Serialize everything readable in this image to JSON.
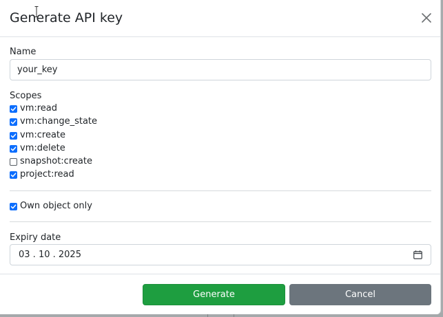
{
  "dialog": {
    "title": "Generate API key",
    "close_icon": "close-icon"
  },
  "name_field": {
    "label": "Name",
    "value": "your_key"
  },
  "scopes": {
    "label": "Scopes",
    "items": [
      {
        "label": "vm:read",
        "checked": true
      },
      {
        "label": "vm:change_state",
        "checked": true
      },
      {
        "label": "vm:create",
        "checked": true
      },
      {
        "label": "vm:delete",
        "checked": true
      },
      {
        "label": "snapshot:create",
        "checked": false
      },
      {
        "label": "project:read",
        "checked": true
      }
    ]
  },
  "own_object": {
    "label": "Own object only",
    "checked": true
  },
  "expiry": {
    "label": "Expiry date",
    "value": "03 . 10 . 2025",
    "icon": "calendar-icon"
  },
  "footer": {
    "generate_label": "Generate",
    "cancel_label": "Cancel"
  },
  "colors": {
    "checkbox_checked": "#0d6efd",
    "generate_button": "#1e9e40",
    "cancel_button": "#6c757d"
  }
}
